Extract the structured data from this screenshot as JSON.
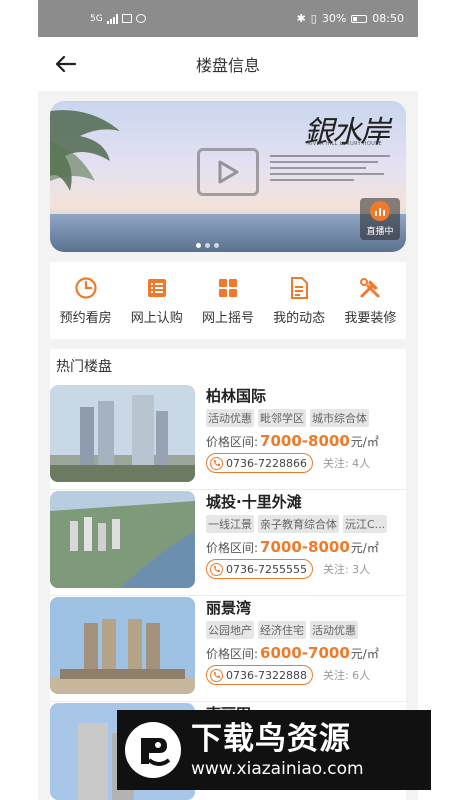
{
  "statusbar": {
    "network": "5G",
    "battery": "30%",
    "time": "08:50"
  },
  "header": {
    "title": "楼盘信息"
  },
  "banner": {
    "calligraphy": "銀水岸",
    "subtitle": "RIVER HILL LUXURY HOUSE",
    "live_label": "直播中"
  },
  "quick_menu": [
    {
      "label": "预约看房",
      "icon": "clock-icon"
    },
    {
      "label": "网上认购",
      "icon": "list-icon"
    },
    {
      "label": "网上摇号",
      "icon": "grid-icon"
    },
    {
      "label": "我的动态",
      "icon": "document-icon"
    },
    {
      "label": "我要装修",
      "icon": "tools-icon"
    }
  ],
  "hot": {
    "title": "热门楼盘",
    "price_prefix": "价格区间:",
    "price_unit": "元/㎡",
    "attention_prefix": "关注:",
    "listings": [
      {
        "name": "柏林国际",
        "tags": [
          "活动优惠",
          "毗邻学区",
          "城市综合体"
        ],
        "price": "7000-8000",
        "phone": "0736-7228866",
        "attention": "4人"
      },
      {
        "name": "城投·十里外滩",
        "tags": [
          "一线江景",
          "亲子教育综合体",
          "沅江C..."
        ],
        "price": "7000-8000",
        "phone": "0736-7255555",
        "attention": "3人"
      },
      {
        "name": "丽景湾",
        "tags": [
          "公园地产",
          "经济住宅",
          "活动优惠"
        ],
        "price": "6000-7000",
        "phone": "0736-7322888",
        "attention": "6人"
      },
      {
        "name": "南丽田",
        "tags": [],
        "price": "",
        "phone": "",
        "attention": ""
      }
    ]
  },
  "watermark": {
    "title": "下载鸟资源",
    "url": "www.xiazainiao.com"
  },
  "colors": {
    "accent": "#f07a2a",
    "statusbar": "#8c8c8c",
    "background": "#f3f3f3"
  }
}
